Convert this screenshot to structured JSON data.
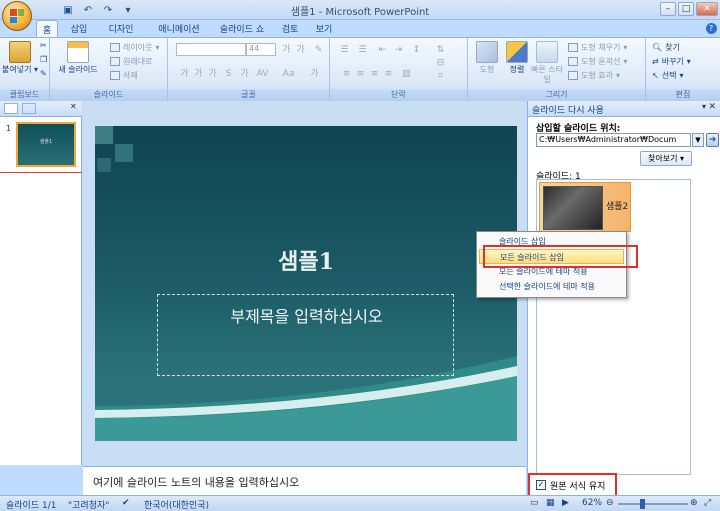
{
  "window": {
    "title": "샘플1 - Microsoft PowerPoint"
  },
  "tabs": [
    "홈",
    "삽입",
    "디자인",
    "애니메이션",
    "슬라이드 쇼",
    "검토",
    "보기"
  ],
  "ribbon": {
    "clipboard": {
      "label": "클립보드",
      "paste": "붙여넣기"
    },
    "slides": {
      "label": "슬라이드",
      "new_slide": "새 슬라이드",
      "layout": "레이아웃",
      "reset": "원래대로",
      "delete": "삭제"
    },
    "font": {
      "label": "글꼴",
      "size": "44"
    },
    "paragraph": {
      "label": "단락"
    },
    "drawing": {
      "label": "그리기",
      "shapes": "도형",
      "arrange": "정렬",
      "quick_styles": "빠른 스타일",
      "fill": "도형 채우기",
      "outline": "도형 윤곽선",
      "effects": "도형 효과"
    },
    "editing": {
      "label": "편집",
      "find": "찾기",
      "replace": "바꾸기",
      "select": "선택"
    }
  },
  "slide": {
    "title": "샘플1",
    "subtitle": "부제목을 입력하십시오",
    "number": "1"
  },
  "notes": {
    "placeholder": "여기에 슬라이드 노트의 내용을 입력하십시오"
  },
  "task_pane": {
    "title": "슬라이드 다시 사용",
    "insert_from_label": "삽입할 슬라이드 위치:",
    "path": "C:₩Users₩Administrator₩Docum",
    "browse": "찾아보기",
    "slides_label": "슬라이드: 1",
    "slide_item": "샘플2",
    "keep_formatting": "원본 서식 유지"
  },
  "context_menu": [
    "슬라이드 삽입",
    "모든 슬라이드 삽입",
    "모든 슬라이드에 테마 적용",
    "선택한 슬라이드에 테마 적용"
  ],
  "status": {
    "slide": "슬라이드 1/1",
    "theme": "\"고려청자\"",
    "language": "한국어(대한민국)",
    "zoom": "62%"
  },
  "colors": {
    "slide_bg": "#134b56",
    "highlight": "#e0302a",
    "menu_hover": "#ffde7a"
  }
}
